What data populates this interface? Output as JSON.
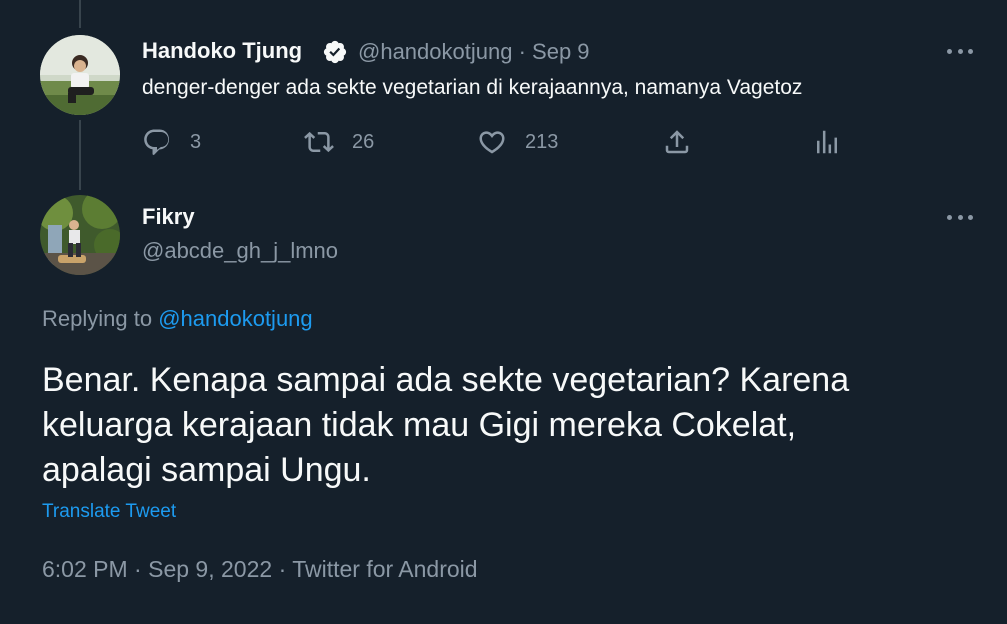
{
  "parent_tweet": {
    "author_name": "Handoko Tjung",
    "author_handle": "@handokotjung",
    "separator": "·",
    "date": "Sep 9",
    "text": "denger-denger ada sekte vegetarian di kerajaannya, namanya Vagetoz",
    "actions": {
      "replies": "3",
      "retweets": "26",
      "likes": "213"
    },
    "icons": [
      "reply-icon",
      "retweet-icon",
      "like-icon",
      "share-icon",
      "analytics-icon",
      "verified-badge-icon",
      "more-icon"
    ]
  },
  "reply_tweet": {
    "author_name": "Fikry",
    "author_handle": "@abcde_gh_j_lmno",
    "replying_prefix": "Replying to",
    "replying_to": "@handokotjung",
    "text_lines": [
      "Benar. Kenapa sampai ada sekte vegetarian? Karena",
      "keluarga kerajaan tidak mau Gigi mereka Cokelat,",
      "apalagi sampai Ungu."
    ],
    "translate_label": "Translate Tweet",
    "time": "6:02 PM",
    "date": "Sep 9, 2022",
    "source": "Twitter for Android",
    "separator": "·"
  },
  "colors": {
    "background": "#15202b",
    "text_primary": "#f7f9f9",
    "text_secondary": "#8b98a5",
    "accent": "#1d9bf0",
    "thread_line": "#38444d"
  }
}
